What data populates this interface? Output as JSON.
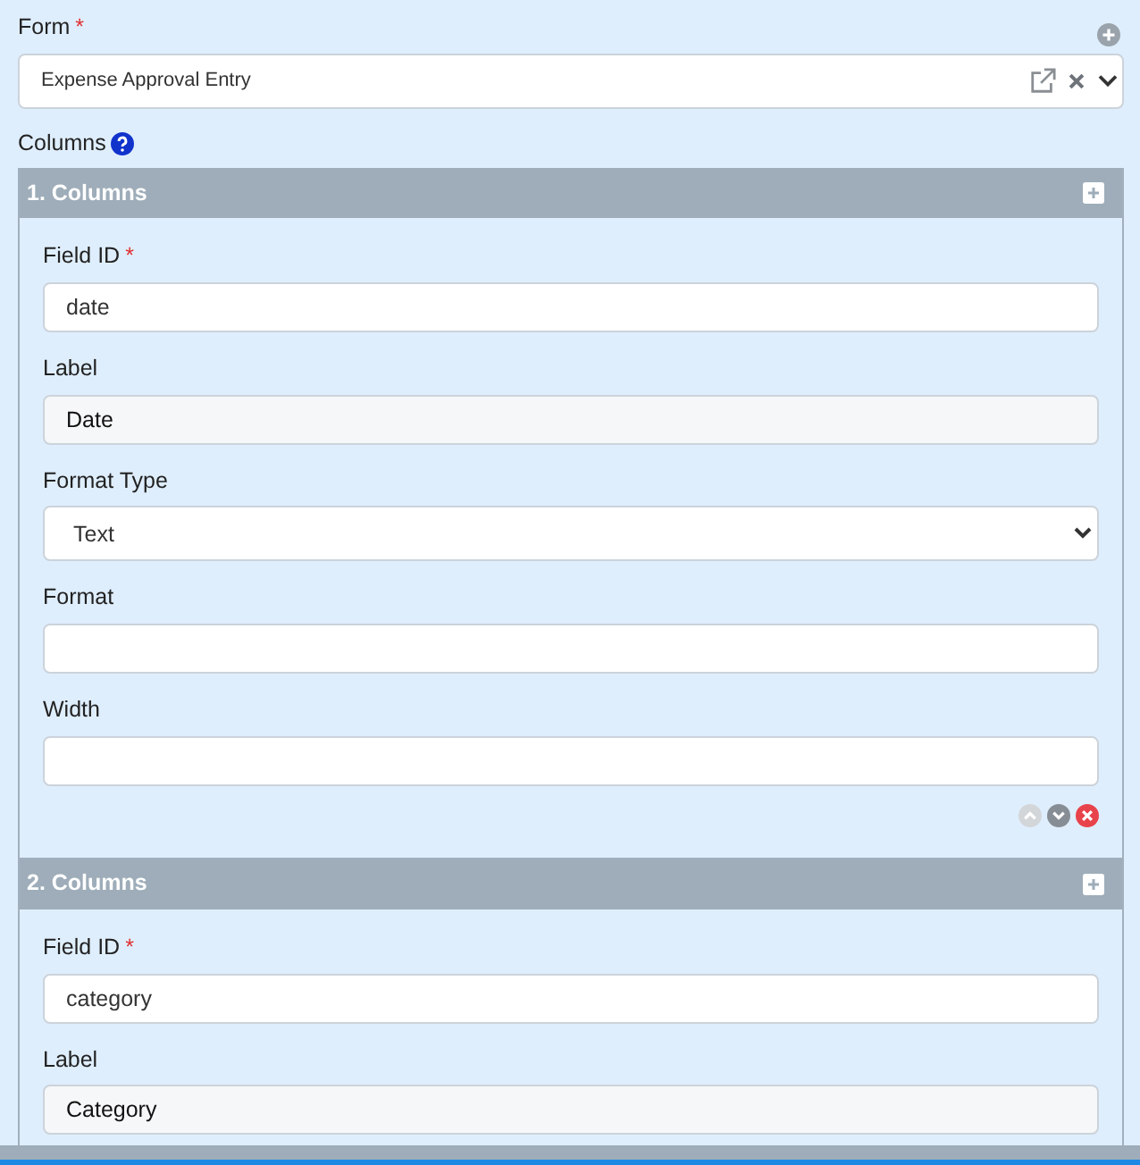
{
  "form": {
    "label": "Form",
    "required_mark": "*",
    "value": "Expense Approval Entry"
  },
  "columns_label": "Columns",
  "sections": [
    {
      "title": "1. Columns",
      "fields": [
        {
          "label": "Field ID",
          "required_mark": "*",
          "kind": "input",
          "value": "date"
        },
        {
          "label": "Label",
          "kind": "readonly",
          "value": "Date"
        },
        {
          "label": "Format Type",
          "kind": "select",
          "value": "Text"
        },
        {
          "label": "Format",
          "kind": "input"
        },
        {
          "label": "Width",
          "kind": "input"
        }
      ],
      "controls": {
        "up_disabled": true,
        "down_disabled": false
      }
    },
    {
      "title": "2. Columns",
      "fields": [
        {
          "label": "Field ID",
          "required_mark": "*",
          "kind": "input",
          "value": "category"
        },
        {
          "label": "Label",
          "kind": "readonly",
          "value": "Category"
        }
      ]
    }
  ]
}
